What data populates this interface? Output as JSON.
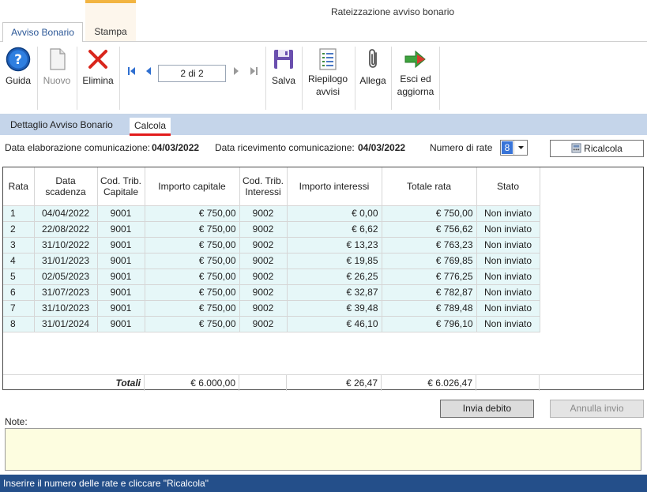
{
  "window": {
    "title": "Rateizzazione avviso bonario"
  },
  "app_tabs": [
    {
      "label": "Avviso Bonario"
    },
    {
      "label": "Stampa"
    }
  ],
  "ribbon": {
    "guida": "Guida",
    "nuovo": "Nuovo",
    "elimina": "Elimina",
    "record": "2 di 2",
    "salva": "Salva",
    "riepilogo_line1": "Riepilogo",
    "riepilogo_line2": "avvisi",
    "allega": "Allega",
    "esci_line1": "Esci ed",
    "esci_line2": "aggiorna"
  },
  "subtabs": [
    {
      "label": "Dettaglio Avviso Bonario"
    },
    {
      "label": "Calcola"
    }
  ],
  "info": {
    "data_elab_label": "Data elaborazione comunicazione:",
    "data_elab_value": "04/03/2022",
    "data_ric_label": "Data ricevimento comunicazione:",
    "data_ric_value": "04/03/2022",
    "numero_rate_label": "Numero di rate",
    "numero_rate_value": "8",
    "ricalcola_label": "Ricalcola"
  },
  "table": {
    "headers": [
      "Rata",
      "Data scadenza",
      "Cod. Trib. Capitale",
      "Importo capitale",
      "Cod. Trib. Interessi",
      "Importo interessi",
      "Totale rata",
      "Stato"
    ],
    "rows": [
      [
        "1",
        "04/04/2022",
        "9001",
        "€ 750,00",
        "9002",
        "€ 0,00",
        "€ 750,00",
        "Non inviato"
      ],
      [
        "2",
        "22/08/2022",
        "9001",
        "€ 750,00",
        "9002",
        "€ 6,62",
        "€ 756,62",
        "Non inviato"
      ],
      [
        "3",
        "31/10/2022",
        "9001",
        "€ 750,00",
        "9002",
        "€ 13,23",
        "€ 763,23",
        "Non inviato"
      ],
      [
        "4",
        "31/01/2023",
        "9001",
        "€ 750,00",
        "9002",
        "€ 19,85",
        "€ 769,85",
        "Non inviato"
      ],
      [
        "5",
        "02/05/2023",
        "9001",
        "€ 750,00",
        "9002",
        "€ 26,25",
        "€ 776,25",
        "Non inviato"
      ],
      [
        "6",
        "31/07/2023",
        "9001",
        "€ 750,00",
        "9002",
        "€ 32,87",
        "€ 782,87",
        "Non inviato"
      ],
      [
        "7",
        "31/10/2023",
        "9001",
        "€ 750,00",
        "9002",
        "€ 39,48",
        "€ 789,48",
        "Non inviato"
      ],
      [
        "8",
        "31/01/2024",
        "9001",
        "€ 750,00",
        "9002",
        "€ 46,10",
        "€ 796,10",
        "Non inviato"
      ]
    ],
    "totals_label": "Totali",
    "totals_capitale": "€ 6.000,00",
    "totals_interessi": "€ 26,47",
    "totals_rata": "€ 6.026,47"
  },
  "actions": {
    "invia_debito": "Invia debito",
    "annulla_invio": "Annulla invio"
  },
  "note_label": "Note:",
  "status_text": "Inserire il numero delle rate e cliccare \"Ricalcola\"",
  "colors": {
    "accent": "#2b5797",
    "context_tab": "#f2b441",
    "row_bg": "#e6f7f8",
    "subtab_bar": "#c5d5ea",
    "status_bar": "#244f8a",
    "active_underline": "#e21b1b"
  }
}
